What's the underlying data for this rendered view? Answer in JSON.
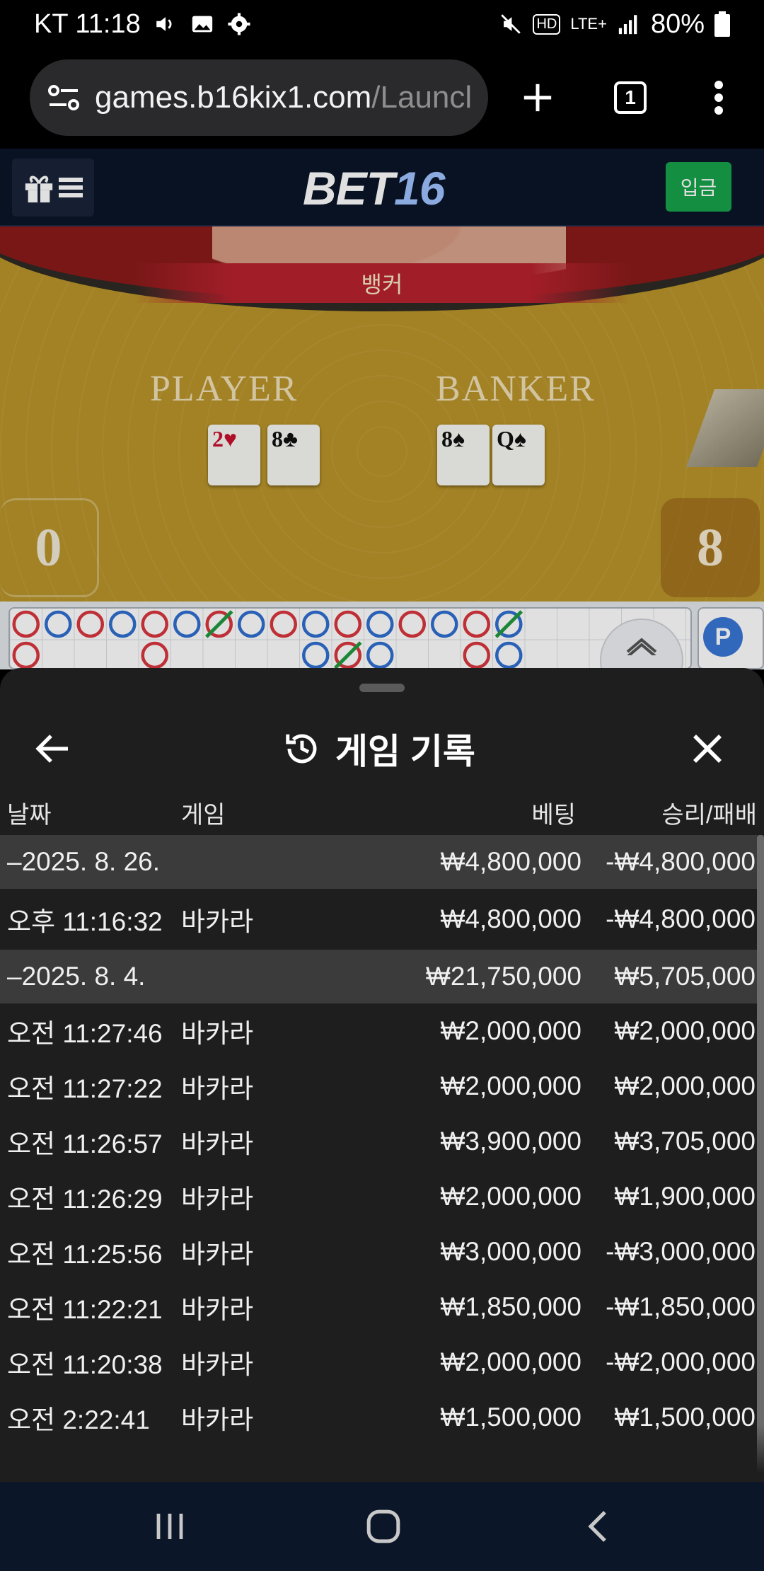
{
  "status_bar": {
    "carrier_time": "KT 11:18",
    "network": "LTE+",
    "hd_badge": "HD",
    "battery": "80%"
  },
  "browser": {
    "url_host": "games.b16kix1.com",
    "url_path": "/Launcl",
    "tab_count": "1"
  },
  "site_header": {
    "logo_part1": "BET",
    "logo_part2": "16",
    "deposit_label": "입금"
  },
  "game_view": {
    "result_banner": "뱅커",
    "player_label": "PLAYER",
    "banker_label": "BANKER",
    "player_score": "0",
    "banker_score": "8",
    "player_cards": [
      {
        "rank": "2",
        "suit": "♥",
        "color": "red"
      },
      {
        "rank": "8",
        "suit": "♣",
        "color": "black"
      }
    ],
    "banker_cards": [
      {
        "rank": "8",
        "suit": "♠",
        "color": "black"
      },
      {
        "rank": "Q",
        "suit": "♠",
        "color": "black"
      }
    ],
    "road_badge": "P"
  },
  "history": {
    "title": "게임 기록",
    "columns": {
      "date": "날짜",
      "game": "게임",
      "bet": "베팅",
      "winloss": "승리/패배"
    },
    "rows": [
      {
        "type": "group",
        "date": "–2025. 8. 26.",
        "bet": "₩4,800,000",
        "winloss": "-₩4,800,000"
      },
      {
        "type": "item",
        "date": "오후 11:16:32",
        "game": "바카라",
        "bet": "₩4,800,000",
        "winloss": "-₩4,800,000"
      },
      {
        "type": "group",
        "date": "–2025. 8. 4.",
        "bet": "₩21,750,000",
        "winloss": "₩5,705,000"
      },
      {
        "type": "item",
        "date": "오전 11:27:46",
        "game": "바카라",
        "bet": "₩2,000,000",
        "winloss": "₩2,000,000"
      },
      {
        "type": "item",
        "date": "오전 11:27:22",
        "game": "바카라",
        "bet": "₩2,000,000",
        "winloss": "₩2,000,000"
      },
      {
        "type": "item",
        "date": "오전 11:26:57",
        "game": "바카라",
        "bet": "₩3,900,000",
        "winloss": "₩3,705,000"
      },
      {
        "type": "item",
        "date": "오전 11:26:29",
        "game": "바카라",
        "bet": "₩2,000,000",
        "winloss": "₩1,900,000"
      },
      {
        "type": "item",
        "date": "오전 11:25:56",
        "game": "바카라",
        "bet": "₩3,000,000",
        "winloss": "-₩3,000,000"
      },
      {
        "type": "item",
        "date": "오전 11:22:21",
        "game": "바카라",
        "bet": "₩1,850,000",
        "winloss": "-₩1,850,000"
      },
      {
        "type": "item",
        "date": "오전 11:20:38",
        "game": "바카라",
        "bet": "₩2,000,000",
        "winloss": "-₩2,000,000"
      },
      {
        "type": "item",
        "date": "오전 2:22:41",
        "game": "바카라",
        "bet": "₩1,500,000",
        "winloss": "₩1,500,000"
      }
    ]
  },
  "icons": {
    "status": [
      "volume-icon",
      "image-icon",
      "settings-icon",
      "mute-icon",
      "signal-icon",
      "battery-icon"
    ],
    "browser": [
      "site-info-icon",
      "new-tab-icon",
      "tabs-icon",
      "more-icon"
    ],
    "sheet": [
      "back-arrow-icon",
      "history-icon",
      "close-icon"
    ],
    "nav": [
      "recents-icon",
      "home-icon",
      "back-icon"
    ]
  },
  "colors": {
    "felt": "#b99429",
    "banner_red": "#b8222e",
    "deposit_green": "#17a34a",
    "header_navy": "#0b1528",
    "sheet_bg": "#1e1e1e",
    "group_row_bg": "#3b3b3b",
    "road_red": "#d9363e",
    "road_blue": "#2f6fd1",
    "tie_green": "#1f9a3e"
  }
}
